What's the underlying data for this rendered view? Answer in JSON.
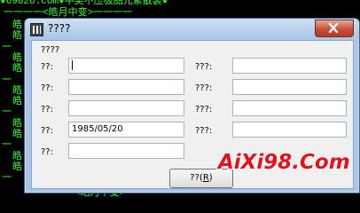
{
  "background": {
    "top_line": "★69026.com★中奖不压极品元素散装★",
    "header_line": "一一一一<皓月中变>一一一一",
    "bottom_line": "一一一一<皓月中变>一一",
    "side_chars": [
      "皓",
      "皓",
      "一",
      "皓",
      "皓",
      "一",
      "皓",
      "皓",
      "一",
      "皓",
      "皓",
      "一",
      "皓",
      "皓",
      "一"
    ]
  },
  "window": {
    "title": "????",
    "close_label": "close"
  },
  "form": {
    "group_label": "????",
    "left_fields": [
      {
        "label": "??:",
        "value": ""
      },
      {
        "label": "??:",
        "value": ""
      },
      {
        "label": "??:",
        "value": ""
      },
      {
        "label": "??:",
        "value": "1985/05/20"
      },
      {
        "label": "??:",
        "value": ""
      }
    ],
    "right_fields": [
      {
        "label": "???:",
        "value": ""
      },
      {
        "label": "???:",
        "value": ""
      },
      {
        "label": "???:",
        "value": ""
      },
      {
        "label": "???:",
        "value": ""
      }
    ]
  },
  "button": {
    "label": "??(",
    "hotkey": "R",
    "suffix": ")"
  },
  "watermark": "AiXi98.Com"
}
